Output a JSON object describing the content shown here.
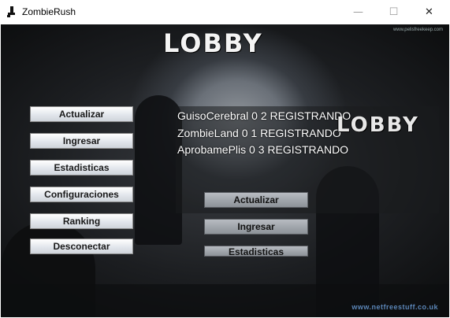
{
  "window": {
    "title": "ZombieRush"
  },
  "controls": {
    "minimize": "—",
    "maximize": "☐",
    "close": "✕"
  },
  "background": {
    "watermark_top": "www.pelisfreekeep.com",
    "credit_bottom": "www.netfreestuff.co.uk"
  },
  "logo": {
    "big": "LOBBY",
    "small": "LOBBY"
  },
  "menu": [
    {
      "label": "Actualizar"
    },
    {
      "label": "Ingresar"
    },
    {
      "label": "Estadisticas"
    },
    {
      "label": "Configuraciones"
    },
    {
      "label": "Ranking"
    },
    {
      "label": "Desconectar"
    }
  ],
  "server_list": [
    {
      "text": "GuisoCerebral 0 2 REGISTRANDO"
    },
    {
      "text": "ZombieLand 0 1 REGISTRANDO"
    },
    {
      "text": "AprobamePlis 0 3 REGISTRANDO"
    }
  ],
  "ghost_menu": [
    {
      "label": "Actualizar"
    },
    {
      "label": "Ingresar"
    },
    {
      "label": "Estadisticas"
    }
  ],
  "colors": {
    "accent_link": "#5b86b8",
    "button_face": "#e2e6ec"
  }
}
